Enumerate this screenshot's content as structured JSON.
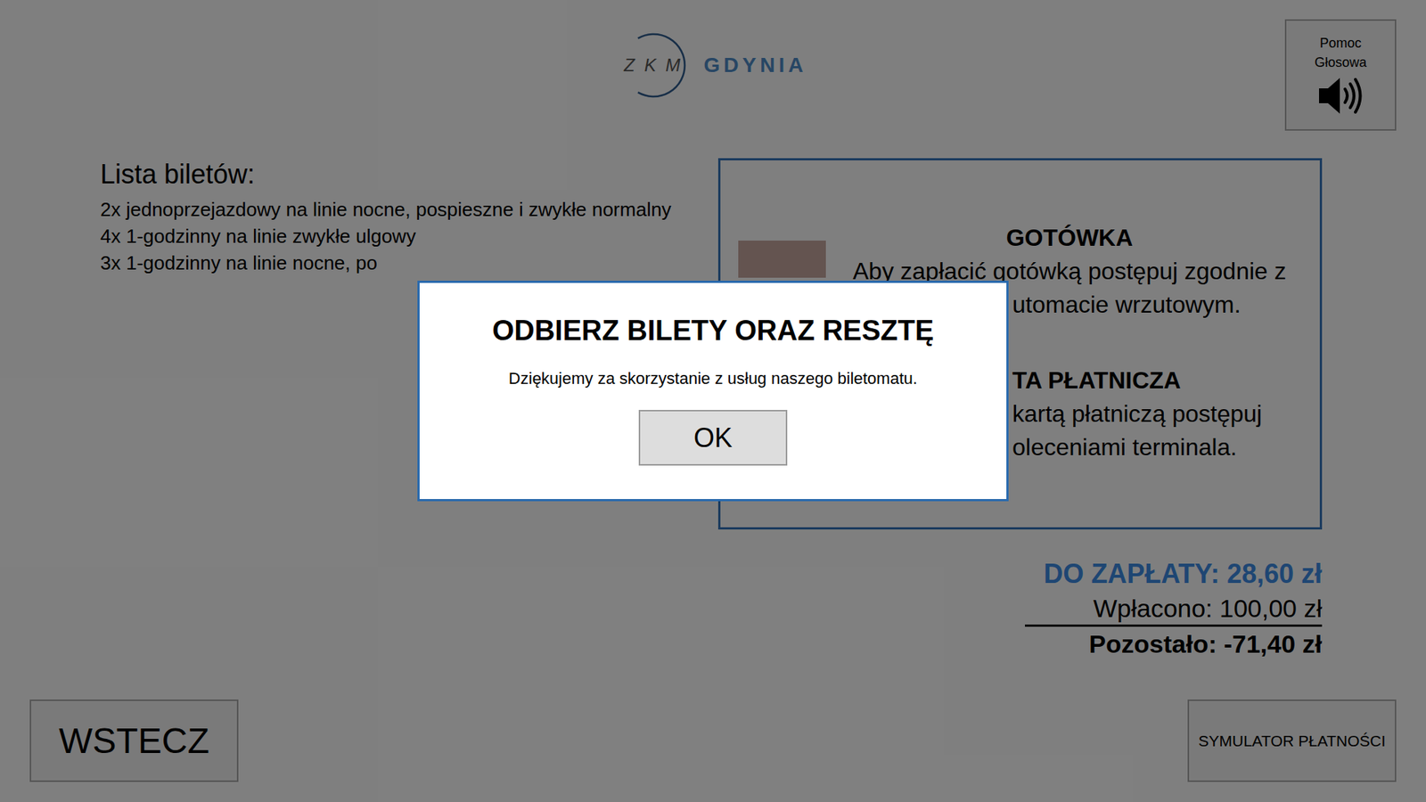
{
  "logo": {
    "letters": "Z K M",
    "city": "GDYNIA"
  },
  "voice_help": {
    "lines": [
      "Pomoc",
      "Głosowa"
    ]
  },
  "ticket_list": {
    "title": "Lista biletów:",
    "items": [
      "2x jednoprzejazdowy na linie nocne, pospieszne i zwykłe normalny",
      "4x 1-godzinny na linie zwykłe ulgowy",
      "3x 1-godzinny na linie nocne, po"
    ]
  },
  "payment_panel": {
    "cash": {
      "title": "GOTÓWKA",
      "lines": [
        "Aby zapłacić gotówką postępuj zgodnie z",
        "utomacie wrzutowym."
      ]
    },
    "card": {
      "title": "TA PŁATNICZA",
      "lines": [
        "kartą płatniczą postępuj",
        "oleceniami terminala."
      ]
    }
  },
  "summary": {
    "due": "DO ZAPŁATY: 28,60 zł",
    "paid": "Wpłacono: 100,00 zł",
    "remaining": "Pozostało: -71,40 zł"
  },
  "buttons": {
    "back": "WSTECZ",
    "simulator": "SYMULATOR PŁATNOŚCI"
  },
  "dialog": {
    "title": "ODBIERZ BILETY ORAZ RESZTĘ",
    "message": "Dziękujemy za skorzystanie z usług naszego biletomatu.",
    "button": "OK"
  }
}
